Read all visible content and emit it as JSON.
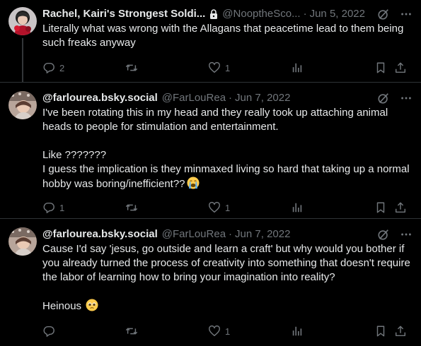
{
  "colors": {
    "background": "#000000",
    "text_primary": "#e7e9ea",
    "text_secondary": "#71767b",
    "divider": "#2f3336"
  },
  "tweets": [
    {
      "display_name": "Rachel, Kairi's Strongest Soldi...",
      "protected_icon": "lock-icon",
      "handle": "@NooptheSco...",
      "separator": "·",
      "date": "Jun 5, 2022",
      "text": "Literally what was wrong with the Allagans that peacetime lead to them being such freaks anyway",
      "reply_count": "2",
      "retweet_count": "",
      "like_count": "1",
      "view_count": ""
    },
    {
      "display_name": "@farlourea.bsky.social",
      "handle": "@FarLouRea",
      "separator": "·",
      "date": "Jun 7, 2022",
      "text": "I've been rotating this in my head and they really took up attaching animal heads to people for stimulation and entertainment.\n\nLike ???????\nI guess the implication is they minmaxed living so hard that taking up a normal hobby was boring/inefficient??",
      "emoji": "loudly-crying-face-emoji",
      "reply_count": "1",
      "retweet_count": "",
      "like_count": "1",
      "view_count": ""
    },
    {
      "display_name": "@farlourea.bsky.social",
      "handle": "@FarLouRea",
      "separator": "·",
      "date": "Jun 7, 2022",
      "text": "Cause I'd say 'jesus, go outside and learn a craft' but why would you bother if you already turned the process of creativity into something that doesn't require the labor of learning how to bring your imagination into reality?\n\nHeinous",
      "emoji": "pleading-face-emoji",
      "reply_count": "",
      "retweet_count": "",
      "like_count": "1",
      "view_count": ""
    }
  ]
}
